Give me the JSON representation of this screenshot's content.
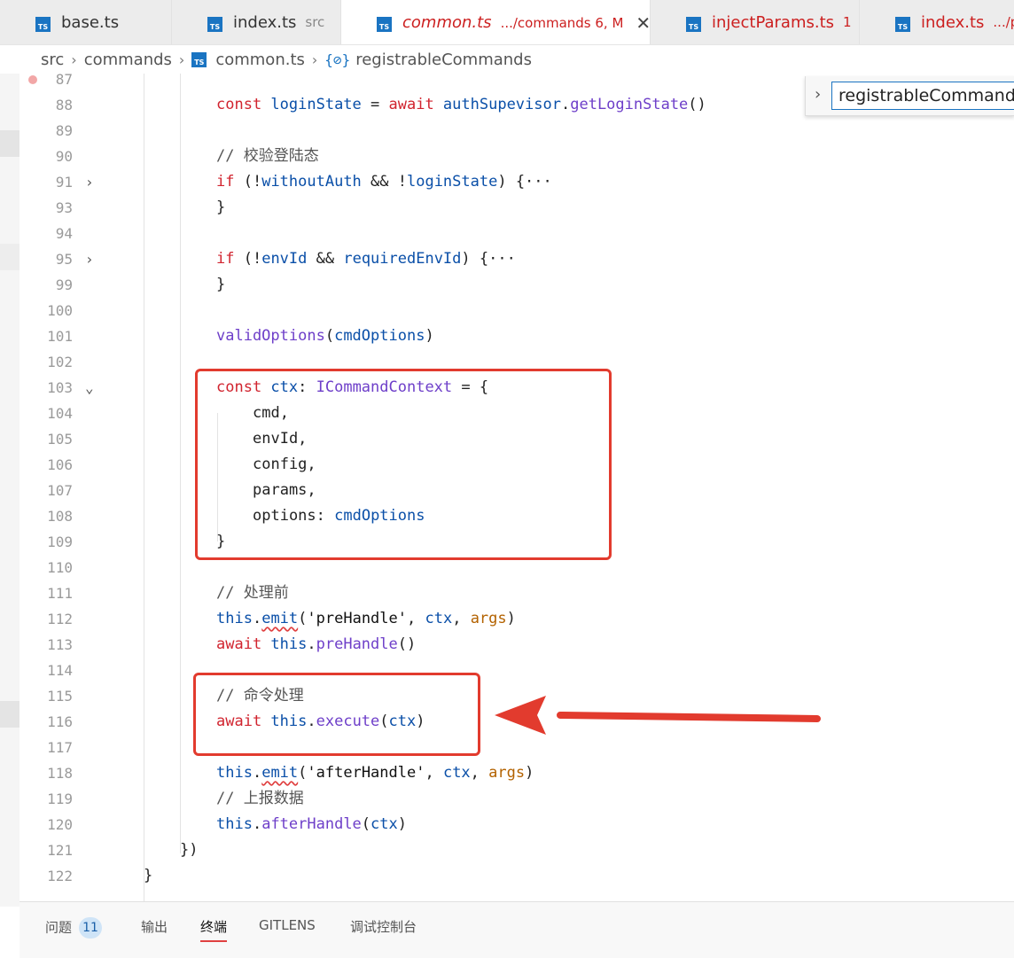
{
  "tabs": [
    {
      "name": "base.ts",
      "desc": "",
      "badge": "TS",
      "state": "normal"
    },
    {
      "name": "index.ts",
      "desc": "src",
      "badge": "TS",
      "state": "normal"
    },
    {
      "name": "common.ts",
      "desc": ".../commands 6, M",
      "badge": "TS",
      "state": "active"
    },
    {
      "name": "injectParams.ts",
      "desc": "1",
      "badge": "TS",
      "state": "error"
    },
    {
      "name": "index.ts",
      "desc": ".../para",
      "badge": "TS",
      "state": "error"
    }
  ],
  "breadcrumb": {
    "parts": [
      "src",
      "commands",
      "common.ts",
      "registrableCommands"
    ],
    "file_badge": "TS",
    "symbol_icon": "{⊘}"
  },
  "sticky": {
    "text": "registrableCommands"
  },
  "editor": {
    "lines": [
      {
        "n": "87",
        "indent": 0,
        "fold": "",
        "toks": []
      },
      {
        "n": "88",
        "indent": 0,
        "fold": "",
        "toks": [
          [
            "kw",
            "const "
          ],
          [
            "id",
            "loginState"
          ],
          [
            "pn",
            " = "
          ],
          [
            "kw",
            "await "
          ],
          [
            "id",
            "authSupevisor"
          ],
          [
            "pn",
            "."
          ],
          [
            "fn",
            "getLoginState"
          ],
          [
            "pn",
            "()"
          ]
        ]
      },
      {
        "n": "89",
        "indent": 0,
        "fold": "",
        "toks": []
      },
      {
        "n": "90",
        "indent": 0,
        "fold": "",
        "toks": [
          [
            "cm",
            "// 校验登陆态"
          ]
        ]
      },
      {
        "n": "91",
        "indent": 0,
        "fold": "›",
        "toks": [
          [
            "kw",
            "if "
          ],
          [
            "pn",
            "(!"
          ],
          [
            "id",
            "withoutAuth"
          ],
          [
            "pn",
            " && !"
          ],
          [
            "id",
            "loginState"
          ],
          [
            "pn",
            ") {···"
          ]
        ]
      },
      {
        "n": "93",
        "indent": 0,
        "fold": "",
        "toks": [
          [
            "pn",
            "}"
          ]
        ]
      },
      {
        "n": "94",
        "indent": 0,
        "fold": "",
        "toks": []
      },
      {
        "n": "95",
        "indent": 0,
        "fold": "›",
        "toks": [
          [
            "kw",
            "if "
          ],
          [
            "pn",
            "(!"
          ],
          [
            "id",
            "envId"
          ],
          [
            "pn",
            " && "
          ],
          [
            "id",
            "requiredEnvId"
          ],
          [
            "pn",
            ") {···"
          ]
        ]
      },
      {
        "n": "99",
        "indent": 0,
        "fold": "",
        "toks": [
          [
            "pn",
            "}"
          ]
        ]
      },
      {
        "n": "100",
        "indent": 0,
        "fold": "",
        "toks": []
      },
      {
        "n": "101",
        "indent": 0,
        "fold": "",
        "toks": [
          [
            "fn",
            "validOptions"
          ],
          [
            "pn",
            "("
          ],
          [
            "id",
            "cmdOptions"
          ],
          [
            "pn",
            ")"
          ]
        ]
      },
      {
        "n": "102",
        "indent": 0,
        "fold": "",
        "toks": []
      },
      {
        "n": "103",
        "indent": 0,
        "fold": "⌄",
        "toks": [
          [
            "kw",
            "const "
          ],
          [
            "id",
            "ctx"
          ],
          [
            "pn",
            ": "
          ],
          [
            "ty",
            "ICommandContext"
          ],
          [
            "pn",
            " = {"
          ]
        ]
      },
      {
        "n": "104",
        "indent": 1,
        "fold": "",
        "toks": [
          [
            "pn",
            "cmd,"
          ]
        ]
      },
      {
        "n": "105",
        "indent": 1,
        "fold": "",
        "toks": [
          [
            "pn",
            "envId,"
          ]
        ]
      },
      {
        "n": "106",
        "indent": 1,
        "fold": "",
        "toks": [
          [
            "pn",
            "config,"
          ]
        ]
      },
      {
        "n": "107",
        "indent": 1,
        "fold": "",
        "toks": [
          [
            "pn",
            "params,"
          ]
        ]
      },
      {
        "n": "108",
        "indent": 1,
        "fold": "",
        "toks": [
          [
            "pn",
            "options: "
          ],
          [
            "id",
            "cmdOptions"
          ]
        ]
      },
      {
        "n": "109",
        "indent": 0,
        "fold": "",
        "toks": [
          [
            "pn",
            "}"
          ]
        ]
      },
      {
        "n": "110",
        "indent": 0,
        "fold": "",
        "toks": []
      },
      {
        "n": "111",
        "indent": 0,
        "fold": "",
        "toks": [
          [
            "cm",
            "// 处理前"
          ]
        ]
      },
      {
        "n": "112",
        "indent": 0,
        "fold": "",
        "toks": [
          [
            "id",
            "this"
          ],
          [
            "pn",
            "."
          ],
          [
            "fnsq",
            "emit"
          ],
          [
            "pn",
            "("
          ],
          [
            "str",
            "'preHandle'"
          ],
          [
            "pn",
            ", "
          ],
          [
            "id",
            "ctx"
          ],
          [
            "pn",
            ", "
          ],
          [
            "pr",
            "args"
          ],
          [
            "pn",
            ")"
          ]
        ]
      },
      {
        "n": "113",
        "indent": 0,
        "fold": "",
        "toks": [
          [
            "kw",
            "await "
          ],
          [
            "id",
            "this"
          ],
          [
            "pn",
            "."
          ],
          [
            "fn",
            "preHandle"
          ],
          [
            "pn",
            "()"
          ]
        ]
      },
      {
        "n": "114",
        "indent": 0,
        "fold": "",
        "toks": []
      },
      {
        "n": "115",
        "indent": 0,
        "fold": "",
        "toks": [
          [
            "cm",
            "// 命令处理"
          ]
        ]
      },
      {
        "n": "116",
        "indent": 0,
        "fold": "",
        "toks": [
          [
            "kw",
            "await "
          ],
          [
            "id",
            "this"
          ],
          [
            "pn",
            "."
          ],
          [
            "fn",
            "execute"
          ],
          [
            "pn",
            "("
          ],
          [
            "id",
            "ctx"
          ],
          [
            "pn",
            ")"
          ]
        ]
      },
      {
        "n": "117",
        "indent": 0,
        "fold": "",
        "toks": []
      },
      {
        "n": "118",
        "indent": 0,
        "fold": "",
        "toks": [
          [
            "id",
            "this"
          ],
          [
            "pn",
            "."
          ],
          [
            "fnsq",
            "emit"
          ],
          [
            "pn",
            "("
          ],
          [
            "str",
            "'afterHandle'"
          ],
          [
            "pn",
            ", "
          ],
          [
            "id",
            "ctx"
          ],
          [
            "pn",
            ", "
          ],
          [
            "pr",
            "args"
          ],
          [
            "pn",
            ")"
          ]
        ]
      },
      {
        "n": "119",
        "indent": 0,
        "fold": "",
        "toks": [
          [
            "cm",
            "// 上报数据"
          ]
        ]
      },
      {
        "n": "120",
        "indent": 0,
        "fold": "",
        "toks": [
          [
            "id",
            "this"
          ],
          [
            "pn",
            "."
          ],
          [
            "fn",
            "afterHandle"
          ],
          [
            "pn",
            "("
          ],
          [
            "id",
            "ctx"
          ],
          [
            "pn",
            ")"
          ]
        ]
      },
      {
        "n": "121",
        "indent": -1,
        "fold": "",
        "toks": [
          [
            "pn",
            "})"
          ]
        ]
      },
      {
        "n": "122",
        "indent": -2,
        "fold": "",
        "toks": [
          [
            "pn",
            "}"
          ]
        ]
      }
    ]
  },
  "panel": {
    "tabs": [
      {
        "label": "问题",
        "badge": "11",
        "active": false
      },
      {
        "label": "输出",
        "badge": "",
        "active": false
      },
      {
        "label": "终端",
        "badge": "",
        "active": true
      },
      {
        "label": "GITLENS",
        "badge": "",
        "active": false
      },
      {
        "label": "调试控制台",
        "badge": "",
        "active": false
      }
    ]
  },
  "colors": {
    "accent": "#1a74c2",
    "error": "#cc1f1f",
    "annotation": "#e23b2e"
  }
}
